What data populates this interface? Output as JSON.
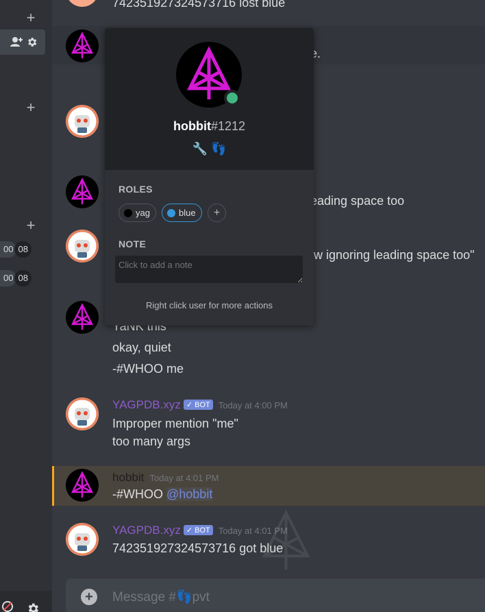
{
  "sidebar": {
    "times": [
      {
        "a": "00",
        "b": "08"
      },
      {
        "a": "00",
        "b": "08"
      }
    ]
  },
  "messages": {
    "top_partial": "742351927324573716 lost blue",
    "partial_1": "e.",
    "partial_2": "eading space too",
    "partial_3": "w ignoring leading space too\"",
    "line_yank": "YaNK this",
    "line_quiet": "okay, quiet",
    "line_whoo": "-#WHOO me",
    "bot1": {
      "name": "YAGPDB.xyz",
      "badge": "✓ BOT",
      "time": "Today at 4:00 PM",
      "line1": "Improper mention \"me\"",
      "line2": "too many args"
    },
    "user1": {
      "name": "hobbit",
      "time": "Today at 4:01 PM",
      "text_prefix": "-#WHOO ",
      "mention": "@hobbit"
    },
    "bot2": {
      "name": "YAGPDB.xyz",
      "badge": "✓ BOT",
      "time": "Today at 4:01 PM",
      "line1": "742351927324573716 got blue"
    }
  },
  "input": {
    "placeholder": "Message #👣pvt"
  },
  "popout": {
    "username": "hobbit",
    "discriminator": "#1212",
    "badges": "🔧 👣",
    "roles_label": "ROLES",
    "roles": [
      {
        "name": "yag",
        "color": "#000000"
      },
      {
        "name": "blue",
        "color": "#3498db"
      }
    ],
    "note_label": "NOTE",
    "note_placeholder": "Click to add a note",
    "footer": "Right click user for more actions",
    "status_color": "#43b581"
  },
  "colors": {
    "accent": "#7289da",
    "bot_name": "#8e5bcb",
    "highlight_border": "#faa61a"
  }
}
